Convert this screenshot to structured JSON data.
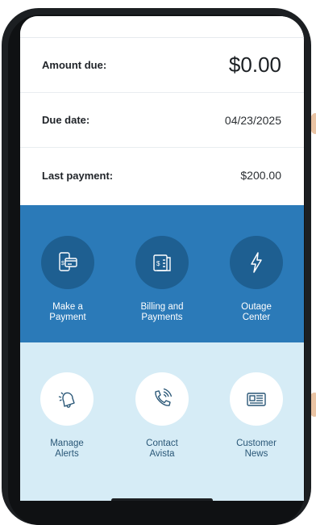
{
  "account": {
    "amount_due_label": "Amount due:",
    "amount_due_value": "$0.00",
    "due_date_label": "Due date:",
    "due_date_value": "04/23/2025",
    "last_payment_label": "Last payment:",
    "last_payment_value": "$200.00"
  },
  "primary_actions": [
    {
      "label": "Make a\nPayment",
      "icon": "payment-card-icon"
    },
    {
      "label": "Billing and\nPayments",
      "icon": "bill-icon"
    },
    {
      "label": "Outage\nCenter",
      "icon": "lightning-bolt-icon"
    }
  ],
  "secondary_actions": [
    {
      "label": "Manage\nAlerts",
      "icon": "bell-icon"
    },
    {
      "label": "Contact\nAvista",
      "icon": "phone-ringing-icon"
    },
    {
      "label": "Customer\nNews",
      "icon": "newspaper-icon"
    }
  ],
  "colors": {
    "primary_panel": "#2b7ab8",
    "primary_circle": "#1e5f91",
    "secondary_panel": "#d6ecf6",
    "secondary_label": "#2a5777"
  }
}
